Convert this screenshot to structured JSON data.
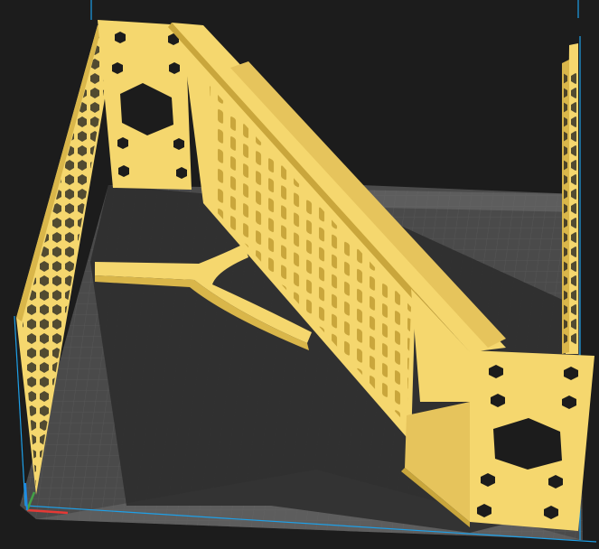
{
  "viewport": {
    "background": "#1c1c1c",
    "bed_color": "#4a4a4a",
    "grid_color": "#5e5e5e",
    "model_color": "#f5d76e",
    "model_shade": "#d9b64a",
    "model_dark": "#b89130",
    "shadow_color": "#2a2a2a",
    "axis_x_color": "#e53935",
    "axis_y_color": "#43a047",
    "axis_z_color": "#1e88e5",
    "build_volume_edge_color": "#00a8ff"
  },
  "icons": {
    "bracket": "3d-model-bracket-icon",
    "axis": "axis-gizmo-icon"
  }
}
